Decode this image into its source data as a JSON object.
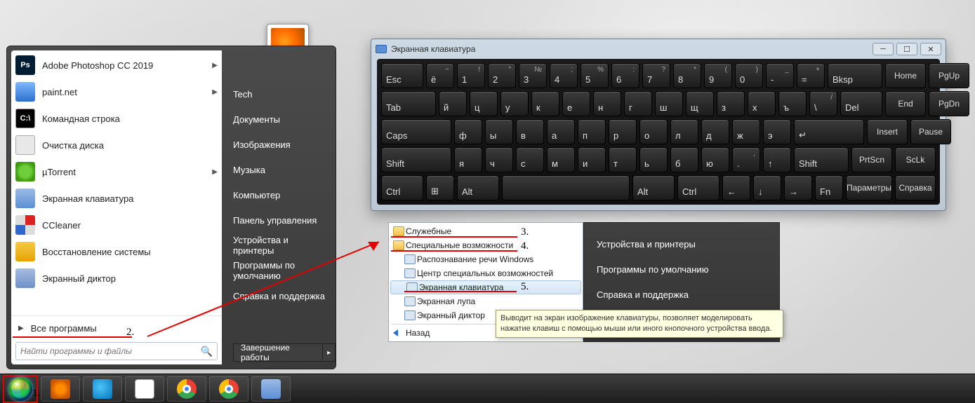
{
  "start_menu": {
    "programs": [
      {
        "label": "Adobe Photoshop CC 2019",
        "icon": "ico-ps",
        "icon_text": "Ps",
        "sub": true
      },
      {
        "label": "paint.net",
        "icon": "ico-pdn",
        "icon_text": "",
        "sub": true
      },
      {
        "label": "Командная строка",
        "icon": "ico-cmd",
        "icon_text": "C:\\",
        "sub": false
      },
      {
        "label": "Очистка диска",
        "icon": "ico-disk",
        "icon_text": "",
        "sub": false
      },
      {
        "label": "µTorrent",
        "icon": "ico-ut",
        "icon_text": "",
        "sub": true
      },
      {
        "label": "Экранная клавиатура",
        "icon": "ico-osk",
        "icon_text": "",
        "sub": false
      },
      {
        "label": "CCleaner",
        "icon": "ico-cc",
        "icon_text": "",
        "sub": false
      },
      {
        "label": "Восстановление системы",
        "icon": "ico-restore",
        "icon_text": "",
        "sub": false
      },
      {
        "label": "Экранный диктор",
        "icon": "ico-narr",
        "icon_text": "",
        "sub": false
      }
    ],
    "all_programs": "Все программы",
    "search_placeholder": "Найти программы и файлы",
    "right_items": [
      "Tech",
      "Документы",
      "Изображения",
      "Музыка",
      "Компьютер",
      "Панель управления",
      "Устройства и принтеры",
      "Программы по умолчанию",
      "Справка и поддержка"
    ],
    "shutdown": "Завершение работы"
  },
  "cascade": {
    "left": [
      {
        "label": "Служебные",
        "type": "folder"
      },
      {
        "label": "Специальные возможности",
        "type": "folder"
      },
      {
        "label": "Распознавание речи Windows",
        "type": "app"
      },
      {
        "label": "Центр специальных возможностей",
        "type": "app"
      },
      {
        "label": "Экранная клавиатура",
        "type": "app",
        "highlight": true
      },
      {
        "label": "Экранная лупа",
        "type": "app"
      },
      {
        "label": "Экранный диктор",
        "type": "app"
      }
    ],
    "back": "Назад",
    "right": [
      "Устройства и принтеры",
      "Программы по умолчанию",
      "Справка и поддержка"
    ],
    "tooltip": "Выводит на экран изображение клавиатуры, позволяет моделировать нажатие клавиш с помощью мыши или иного кнопочного устройства ввода."
  },
  "osk": {
    "title": "Экранная клавиатура",
    "row1": [
      {
        "m": "Esc",
        "cls": "wide"
      },
      {
        "m": "ё",
        "s": "~"
      },
      {
        "m": "1",
        "s": "!"
      },
      {
        "m": "2",
        "s": "\""
      },
      {
        "m": "3",
        "s": "№"
      },
      {
        "m": "4",
        "s": ";"
      },
      {
        "m": "5",
        "s": "%"
      },
      {
        "m": "6",
        "s": ":"
      },
      {
        "m": "7",
        "s": "?"
      },
      {
        "m": "8",
        "s": "*"
      },
      {
        "m": "9",
        "s": "("
      },
      {
        "m": "0",
        "s": ")"
      },
      {
        "m": "-",
        "s": "_"
      },
      {
        "m": "=",
        "s": "+"
      },
      {
        "m": "Bksp",
        "cls": "xwide"
      }
    ],
    "nav1": [
      {
        "m": "Home"
      },
      {
        "m": "PgUp"
      }
    ],
    "row2": [
      {
        "m": "Tab",
        "cls": "xwide"
      },
      {
        "m": "й"
      },
      {
        "m": "ц"
      },
      {
        "m": "у"
      },
      {
        "m": "к"
      },
      {
        "m": "е"
      },
      {
        "m": "н"
      },
      {
        "m": "г"
      },
      {
        "m": "ш"
      },
      {
        "m": "щ"
      },
      {
        "m": "з"
      },
      {
        "m": "х"
      },
      {
        "m": "ъ"
      },
      {
        "m": "\\",
        "s": "/"
      },
      {
        "m": "Del",
        "cls": "wide"
      }
    ],
    "nav2": [
      {
        "m": "End"
      },
      {
        "m": "PgDn"
      }
    ],
    "row3": [
      {
        "m": "Caps",
        "cls": "xxwide"
      },
      {
        "m": "ф"
      },
      {
        "m": "ы"
      },
      {
        "m": "в"
      },
      {
        "m": "а"
      },
      {
        "m": "п"
      },
      {
        "m": "р"
      },
      {
        "m": "о"
      },
      {
        "m": "л"
      },
      {
        "m": "д"
      },
      {
        "m": "ж"
      },
      {
        "m": "э"
      },
      {
        "m": "↵",
        "cls": "xxwide"
      }
    ],
    "nav3": [
      {
        "m": "Insert"
      },
      {
        "m": "Pause"
      }
    ],
    "row4": [
      {
        "m": "Shift",
        "cls": "xxwide"
      },
      {
        "m": "я"
      },
      {
        "m": "ч"
      },
      {
        "m": "с"
      },
      {
        "m": "м"
      },
      {
        "m": "и"
      },
      {
        "m": "т"
      },
      {
        "m": "ь"
      },
      {
        "m": "б"
      },
      {
        "m": "ю"
      },
      {
        "m": ".",
        "s": ","
      },
      {
        "m": "↑"
      },
      {
        "m": "Shift",
        "cls": "xwide"
      }
    ],
    "nav4": [
      {
        "m": "PrtScn"
      },
      {
        "m": "ScLk"
      }
    ],
    "row5": [
      {
        "m": "Ctrl",
        "cls": "wide"
      },
      {
        "m": "⊞",
        "cls": ""
      },
      {
        "m": "Alt",
        "cls": "wide"
      },
      {
        "m": "",
        "cls": "xxwide",
        "space": true
      },
      {
        "m": "Alt",
        "cls": "wide"
      },
      {
        "m": "Ctrl",
        "cls": "wide"
      },
      {
        "m": "←"
      },
      {
        "m": "↓"
      },
      {
        "m": "→"
      },
      {
        "m": "Fn",
        "cls": ""
      }
    ],
    "nav5": [
      {
        "m": "Параметры"
      },
      {
        "m": "Справка"
      }
    ]
  },
  "annotations": {
    "n1": "1.",
    "n2": "2.",
    "n3": "3.",
    "n4": "4.",
    "n5": "5."
  }
}
